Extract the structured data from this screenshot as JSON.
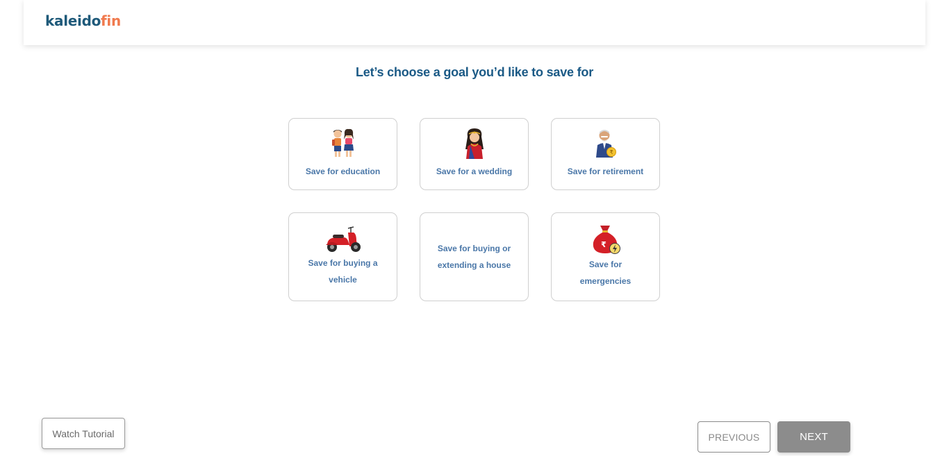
{
  "brand": {
    "part1": "kaleido",
    "part2": "fin",
    "color_primary": "#1f5a7a",
    "color_accent": "#f07a4e"
  },
  "page": {
    "title": "Let’s choose a goal you’d like to save for"
  },
  "goals": [
    {
      "label": "Save for education",
      "icon": "kids-education-icon"
    },
    {
      "label": "Save for a wedding",
      "icon": "bride-wedding-icon"
    },
    {
      "label": "Save for retirement",
      "icon": "elderly-man-retirement-icon"
    },
    {
      "label": "Save for buying a vehicle",
      "icon": "red-scooter-icon"
    },
    {
      "label": "Save for buying or extending a house",
      "icon": ""
    },
    {
      "label": "Save for emergencies",
      "icon": "rupee-money-bag-icon"
    }
  ],
  "footer": {
    "tutorial_label": "Watch Tutorial",
    "previous_label": "PREVIOUS",
    "next_label": "NEXT"
  }
}
